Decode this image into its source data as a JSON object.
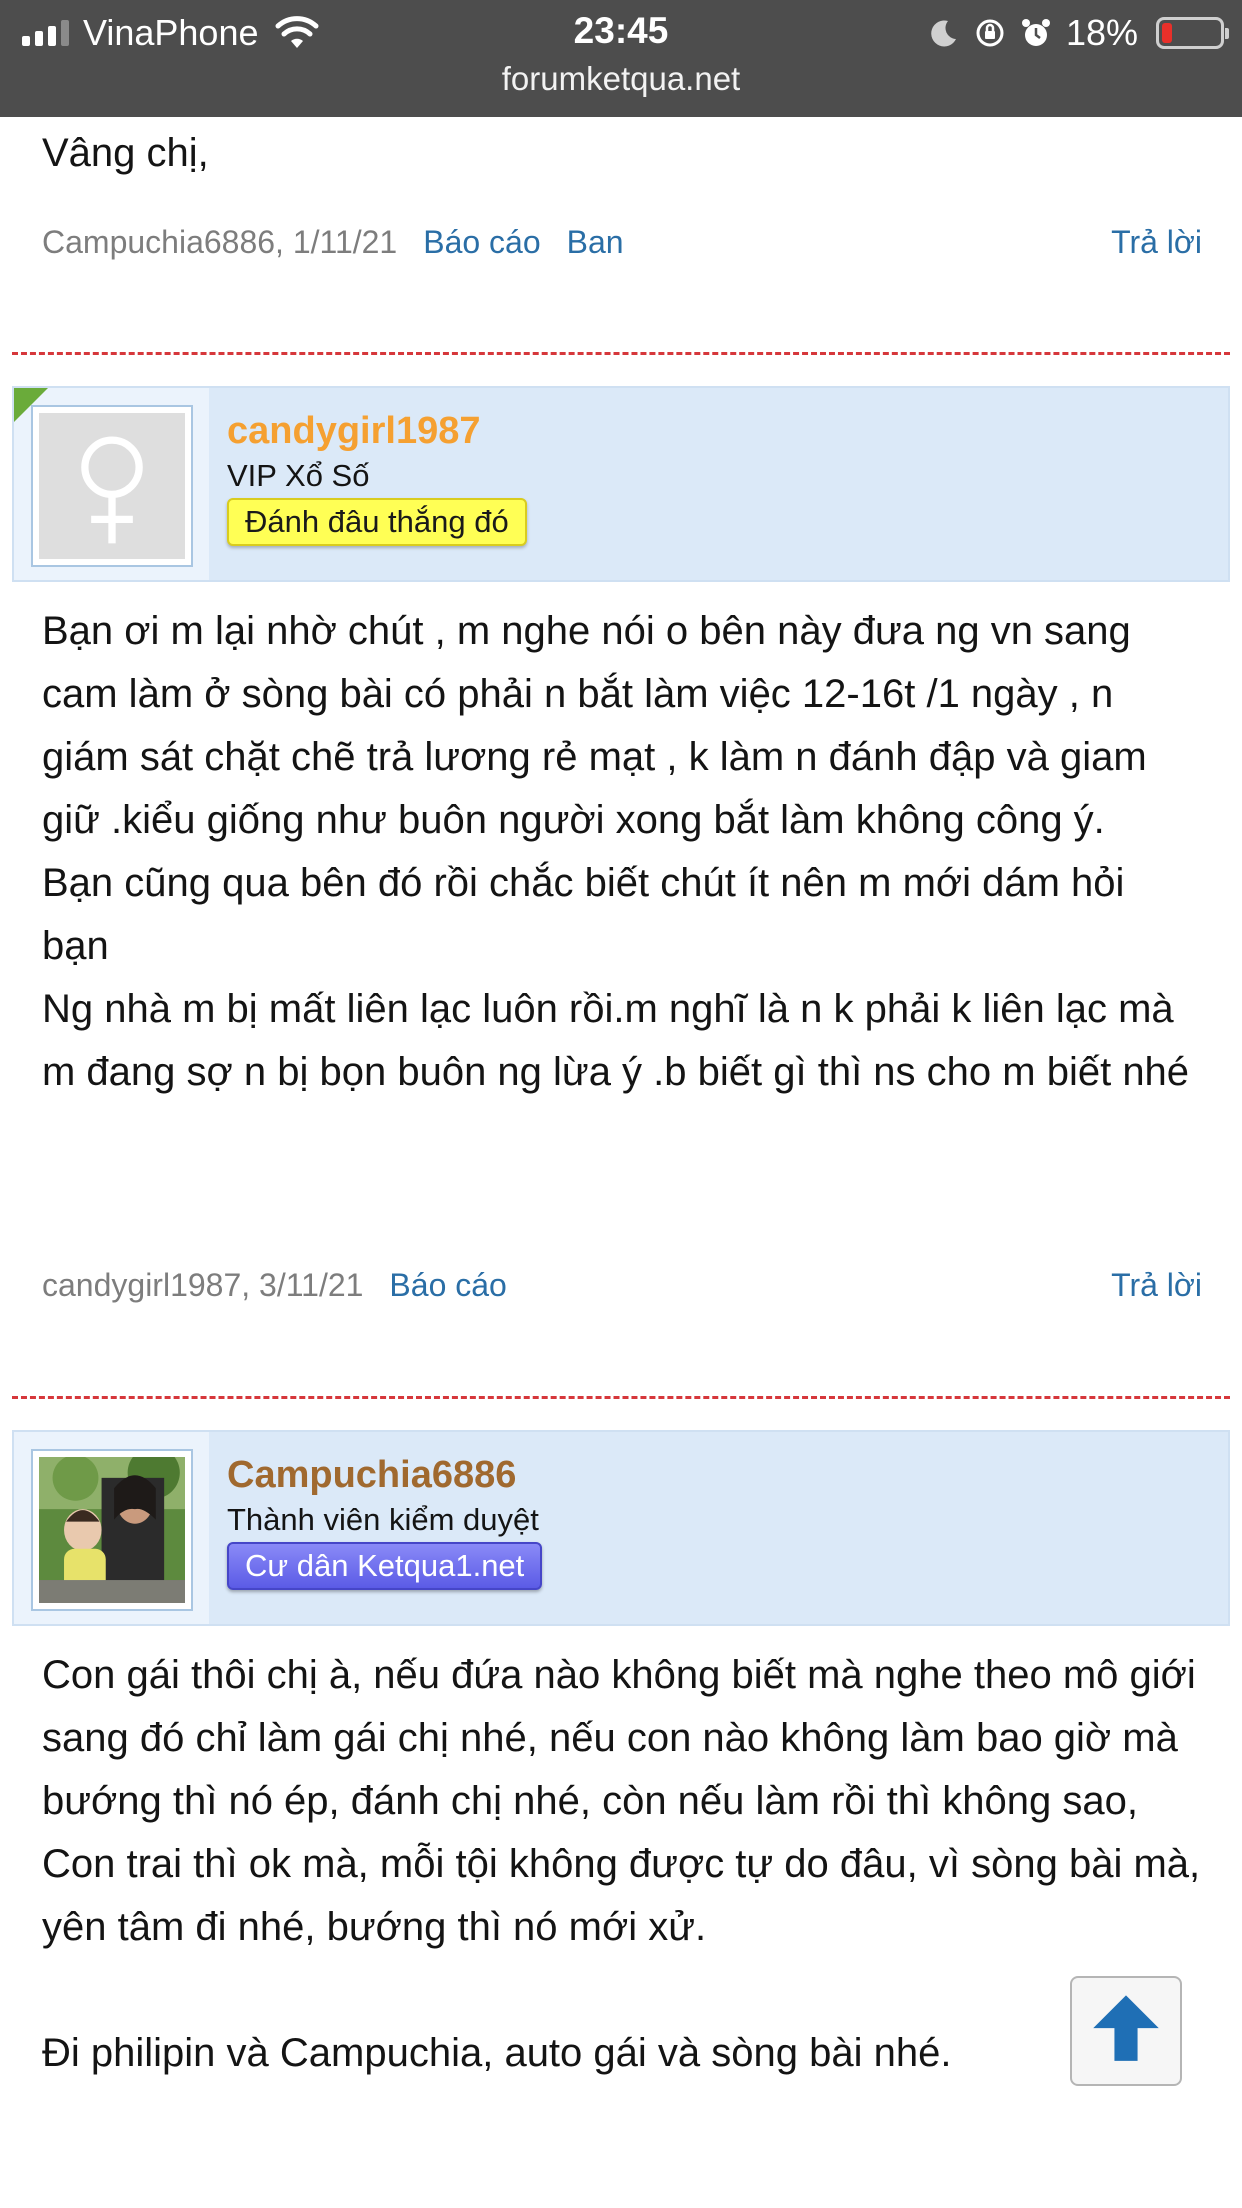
{
  "status_bar": {
    "carrier": "VinaPhone",
    "time": "23:45",
    "url": "forumketqua.net",
    "battery": "18%",
    "icons": [
      "signal-icon",
      "wifi-icon",
      "moon-icon",
      "orientation-lock-icon",
      "alarm-icon",
      "battery-icon"
    ]
  },
  "posts": [
    {
      "message": [
        "Vâng chị,"
      ],
      "meta": {
        "author_date": "Campuchia6886, 1/11/21",
        "links": [
          "Báo cáo",
          "Ban"
        ],
        "reply": "Trả lời"
      }
    },
    {
      "user": {
        "name": "candygirl1987",
        "role": "VIP Xổ Số",
        "badge": "Đánh đâu thắng đó",
        "name_color": "#f5a031",
        "avatar": "female-symbol-icon"
      },
      "message": [
        "Bạn ơi m lại nhờ chút , m nghe nói o bên này đưa ng vn sang cam làm ở sòng bài có phải n bắt làm việc 12-16t /1 ngày , n giám sát chặt chẽ trả lương rẻ mạt , k làm n đánh đập và giam giữ .kiểu giống như buôn người xong bắt làm không công ý.",
        "Bạn cũng qua bên đó rồi chắc biết chút ít nên m mới dám hỏi bạn",
        "Ng nhà m bị mất liên lạc luôn rồi.m nghĩ là n k phải k liên lạc mà m đang sợ n bị bọn buôn ng lừa ý .b biết gì thì ns cho m biết nhé"
      ],
      "meta": {
        "author_date": "candygirl1987, 3/11/21",
        "links": [
          "Báo cáo"
        ],
        "reply": "Trả lời"
      }
    },
    {
      "user": {
        "name": "Campuchia6886",
        "role": "Thành viên kiểm duyệt",
        "badge": "Cư dân Ketqua1.net",
        "name_color": "#a0692f",
        "avatar": "user-photo"
      },
      "message": [
        "Con gái thôi chị à, nếu đứa nào không biết mà nghe theo mô giới sang đó chỉ làm gái chị nhé, nếu con nào không làm bao giờ mà bướng thì nó ép, đánh chị nhé, còn nếu làm rồi thì không sao,",
        "Con trai thì ok mà, mỗi tội không được tự do đâu, vì sòng bài mà, yên tâm đi nhé, bướng thì nó mới xử.",
        "Đi philipin và Campuchia, auto gái và sòng bài nhé."
      ]
    }
  ],
  "colors": {
    "link": "#2a6ea6",
    "divider": "#d6373b",
    "user_header_bg": "#dbe9f8",
    "status_bar_bg": "#4d4d4d"
  },
  "scroll_top": {
    "icon": "arrow-up-icon"
  }
}
